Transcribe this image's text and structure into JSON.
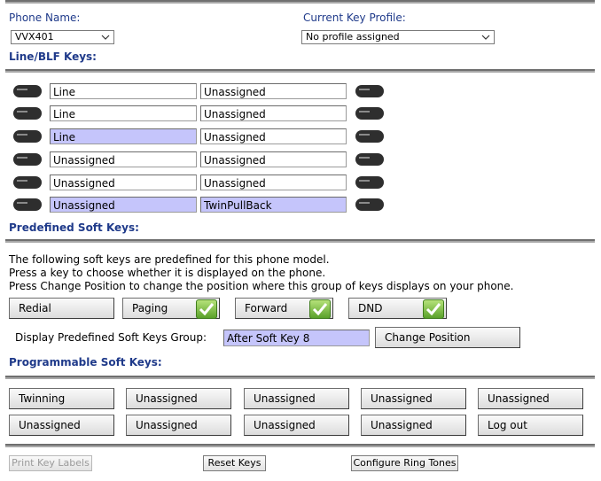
{
  "header": {
    "phone_name_label": "Phone Name:",
    "phone_name_value": "VVX401",
    "key_profile_label": "Current Key Profile:",
    "key_profile_value": "No profile assigned"
  },
  "line_blf": {
    "title": "Line/BLF Keys:",
    "rows": [
      {
        "left": "Line",
        "right": "Unassigned",
        "left_hl": false,
        "right_hl": false
      },
      {
        "left": "Line",
        "right": "Unassigned",
        "left_hl": false,
        "right_hl": false
      },
      {
        "left": "Line",
        "right": "Unassigned",
        "left_hl": true,
        "right_hl": false
      },
      {
        "left": "Unassigned",
        "right": "Unassigned",
        "left_hl": false,
        "right_hl": false
      },
      {
        "left": "Unassigned",
        "right": "Unassigned",
        "left_hl": false,
        "right_hl": false
      },
      {
        "left": "Unassigned",
        "right": "TwinPullBack",
        "left_hl": true,
        "right_hl": true
      }
    ]
  },
  "predefined": {
    "title": "Predefined Soft Keys:",
    "desc1": "The following soft keys are predefined for this phone model.",
    "desc2": "Press a key to choose whether it is displayed on the phone.",
    "desc3": "Press Change Position to change the position where this group of keys displays on your phone.",
    "keys": [
      {
        "label": "Redial",
        "checked": false
      },
      {
        "label": "Paging",
        "checked": true
      },
      {
        "label": "Forward",
        "checked": true
      },
      {
        "label": "DND",
        "checked": true
      }
    ],
    "group_label": "Display Predefined Soft Keys Group:",
    "group_value": "After Soft Key 8",
    "change_position": "Change Position"
  },
  "programmable": {
    "title": "Programmable Soft Keys:",
    "row1": [
      "Twinning",
      "Unassigned",
      "Unassigned",
      "Unassigned",
      "Unassigned"
    ],
    "row2": [
      "Unassigned",
      "Unassigned",
      "Unassigned",
      "Unassigned",
      "Log out"
    ]
  },
  "footer": {
    "print_labels": "Print Key Labels",
    "reset_keys": "Reset Keys",
    "ring_tones": "Configure Ring Tones"
  },
  "colors": {
    "heading": "#1f3a8a",
    "highlight": "#c5c5fb",
    "check_green": "#5aa12a"
  }
}
